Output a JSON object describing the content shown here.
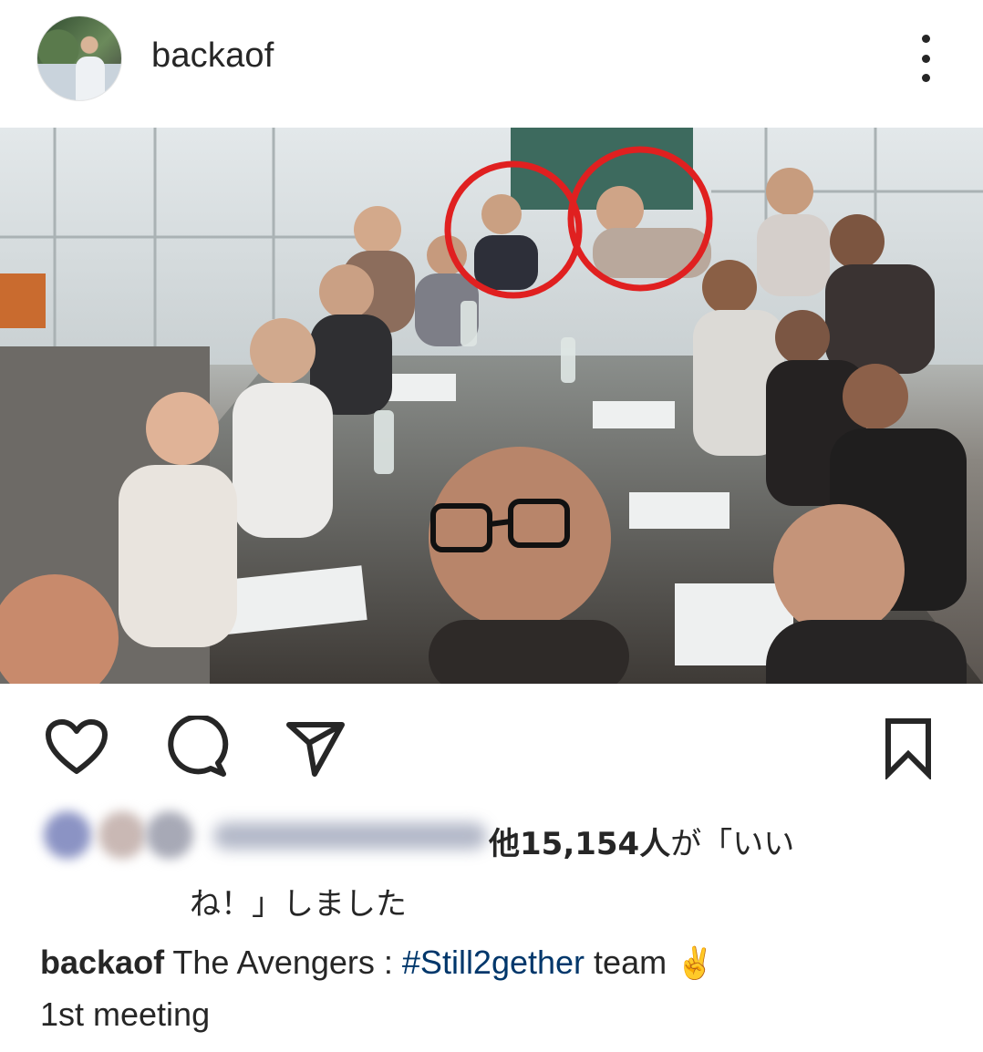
{
  "post": {
    "username": "backaof",
    "menu_icon": "more-vertical-icon"
  },
  "photo": {
    "alt": "group selfie at a conference table",
    "highlight_color": "#e02020"
  },
  "actions": {
    "like_icon": "heart-icon",
    "comment_icon": "comment-icon",
    "share_icon": "send-icon",
    "save_icon": "bookmark-icon"
  },
  "likes": {
    "prefix": "他",
    "count": "15,154人",
    "suffix_line1": "が「いい",
    "line2": "ね！」しました"
  },
  "caption": {
    "username": "backaof",
    "text_before": " The Avengers : ",
    "hashtag": "#Still2gether",
    "text_after": " team ",
    "emoji": "✌",
    "line2": "1st meeting"
  },
  "colors": {
    "text": "#262626",
    "hashtag": "#00376b"
  }
}
